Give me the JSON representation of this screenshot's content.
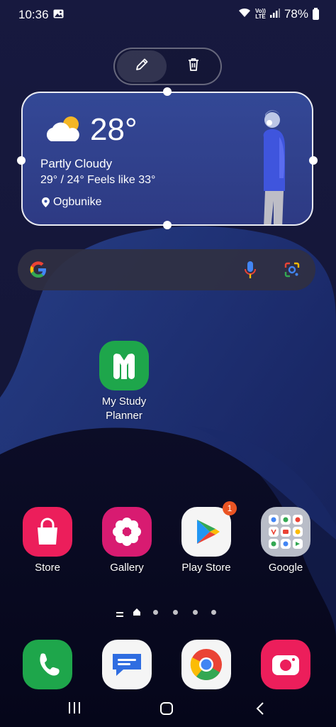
{
  "status_bar": {
    "time": "10:36",
    "battery": "78%",
    "network_label": "Vo)) LTE"
  },
  "edit_toolbar": {
    "edit_icon": "pencil-icon",
    "delete_icon": "trash-icon"
  },
  "weather_widget": {
    "temperature": "28°",
    "condition": "Partly Cloudy",
    "details": "29° / 24° Feels like 33°",
    "location": "Ogbunike",
    "icon": "partly-cloudy-icon"
  },
  "search_bar": {
    "logo": "google-g-icon",
    "mic_icon": "mic-icon",
    "lens_icon": "google-lens-icon"
  },
  "apps": {
    "study_planner": {
      "label": "My Study\nPlanner",
      "line1": "My Study",
      "line2": "Planner"
    },
    "store": {
      "label": "Store"
    },
    "gallery": {
      "label": "Gallery"
    },
    "play_store": {
      "label": "Play Store",
      "badge": "1"
    },
    "google": {
      "label": "Google"
    }
  },
  "dock": [
    {
      "name": "Phone"
    },
    {
      "name": "Messages"
    },
    {
      "name": "Chrome"
    },
    {
      "name": "Camera"
    }
  ],
  "colors": {
    "accent_green": "#1ea64b",
    "store_pink": "#ec1e5b",
    "gallery_magenta": "#d81b71",
    "badge_orange": "#ea5423"
  }
}
